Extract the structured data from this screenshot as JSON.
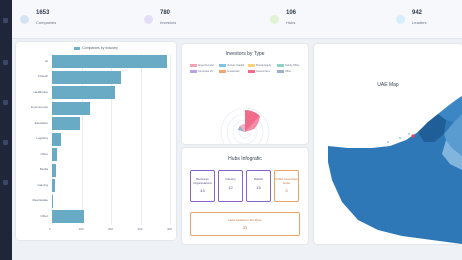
{
  "stats": [
    {
      "value": "1653",
      "label": "Companies",
      "icon": "building-icon",
      "color": "#3b82c4"
    },
    {
      "value": "780",
      "label": "Investors",
      "icon": "investor-icon",
      "color": "#8b7fd4"
    },
    {
      "value": "106",
      "label": "Hubs",
      "icon": "hub-icon",
      "color": "#8fcf6b"
    },
    {
      "value": "942",
      "label": "Leaders",
      "icon": "leader-icon",
      "color": "#4ab3e8"
    }
  ],
  "companies_chart": {
    "legend": "Companies by Industry",
    "categories": [
      "AI",
      "Fintech",
      "Healthcare",
      "E-commerce",
      "Education",
      "Logistics",
      "Other",
      "Media",
      "Gaming",
      "Real Estate",
      "Other"
    ],
    "ticks": [
      "0",
      "100",
      "200",
      "300",
      "400",
      "500"
    ]
  },
  "chart_data": {
    "type": "bar",
    "orientation": "horizontal",
    "legend": [
      "Companies by Industry"
    ],
    "categories": [
      "AI",
      "Fintech",
      "Healthcare",
      "E-commerce",
      "Education",
      "Logistics",
      "Other",
      "Media",
      "Gaming",
      "Real Estate",
      "Other"
    ],
    "values": [
      390,
      235,
      215,
      128,
      95,
      30,
      18,
      15,
      10,
      5,
      108
    ],
    "xlim": [
      0,
      400
    ],
    "grid": true
  },
  "investors_card": {
    "title": "Investors by Type",
    "legend": [
      {
        "label": "Angel Investor",
        "color": "#f4a3b6"
      },
      {
        "label": "Venture Capital",
        "color": "#7fc3e8"
      },
      {
        "label": "Private Equity",
        "color": "#f7d27a"
      },
      {
        "label": "Family Office",
        "color": "#8fd3c6"
      },
      {
        "label": "Corporate VC",
        "color": "#b9a3e8"
      },
      {
        "label": "Accelerator",
        "color": "#f2a86b"
      },
      {
        "label": "Government",
        "color": "#f06b8a"
      },
      {
        "label": "Other",
        "color": "#9fb0c8"
      }
    ]
  },
  "hubs_card": {
    "title": "Hubs Infografic",
    "boxes": [
      {
        "title": "Business Organisations",
        "count": "43"
      },
      {
        "title": "Industry",
        "count": "12"
      },
      {
        "title": "Market",
        "count": "15"
      },
      {
        "title": "Public Innovation Hubs",
        "count": "3"
      }
    ],
    "wide": {
      "title": "Hubs located in the Zone",
      "count": "33"
    }
  },
  "map_card": {
    "title": "UAE Map"
  }
}
